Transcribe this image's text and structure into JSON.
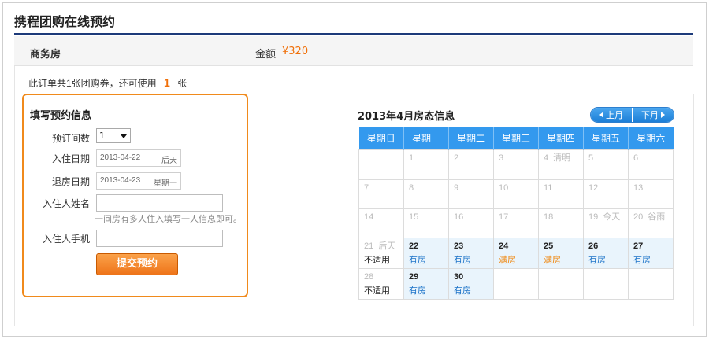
{
  "page": {
    "title": "携程团购在线预约"
  },
  "room": {
    "name": "商务房",
    "amount_label": "金额",
    "amount_value": "¥320"
  },
  "voucher": {
    "text_before": "此订单共1张团购券，还可使用",
    "count": "1",
    "text_after": "张"
  },
  "form": {
    "title": "填写预约信息",
    "rooms_label": "预订间数",
    "rooms_value": "1",
    "checkin_label": "入住日期",
    "checkin_date": "2013-04-22",
    "checkin_day": "后天",
    "checkout_label": "退房日期",
    "checkout_date": "2013-04-23",
    "checkout_day": "星期一",
    "guest_name_label": "入住人姓名",
    "guest_name_value": "",
    "guest_name_hint": "一间房有多人住入填写一人信息即可。",
    "guest_phone_label": "入住人手机",
    "guest_phone_value": "",
    "submit_label": "提交预约"
  },
  "calendar": {
    "title": "2013年4月房态信息",
    "prev_label": "上月",
    "next_label": "下月",
    "weekdays": [
      "星期日",
      "星期一",
      "星期二",
      "星期三",
      "星期四",
      "星期五",
      "星期六"
    ],
    "weeks": [
      [
        {
          "day": "",
          "status": ""
        },
        {
          "day": "1",
          "status": ""
        },
        {
          "day": "2",
          "status": ""
        },
        {
          "day": "3",
          "status": ""
        },
        {
          "day": "4",
          "note": "清明",
          "status": ""
        },
        {
          "day": "5",
          "status": ""
        },
        {
          "day": "6",
          "status": ""
        }
      ],
      [
        {
          "day": "7",
          "status": ""
        },
        {
          "day": "8",
          "status": ""
        },
        {
          "day": "9",
          "status": ""
        },
        {
          "day": "10",
          "status": ""
        },
        {
          "day": "11",
          "status": ""
        },
        {
          "day": "12",
          "status": ""
        },
        {
          "day": "13",
          "status": ""
        }
      ],
      [
        {
          "day": "14",
          "status": ""
        },
        {
          "day": "15",
          "status": ""
        },
        {
          "day": "16",
          "status": ""
        },
        {
          "day": "17",
          "status": ""
        },
        {
          "day": "18",
          "status": ""
        },
        {
          "day": "19",
          "note": "今天",
          "status": ""
        },
        {
          "day": "20",
          "note": "谷雨",
          "status": ""
        }
      ],
      [
        {
          "day": "21",
          "note": "后天",
          "status": "不适用",
          "kind": "na"
        },
        {
          "day": "22",
          "status": "有房",
          "kind": "avail"
        },
        {
          "day": "23",
          "status": "有房",
          "kind": "avail"
        },
        {
          "day": "24",
          "status": "满房",
          "kind": "full"
        },
        {
          "day": "25",
          "status": "满房",
          "kind": "full"
        },
        {
          "day": "26",
          "status": "有房",
          "kind": "avail"
        },
        {
          "day": "27",
          "status": "有房",
          "kind": "avail"
        }
      ],
      [
        {
          "day": "28",
          "status": "不适用",
          "kind": "na"
        },
        {
          "day": "29",
          "status": "有房",
          "kind": "avail"
        },
        {
          "day": "30",
          "status": "有房",
          "kind": "avail"
        },
        {
          "day": "",
          "status": ""
        },
        {
          "day": "",
          "status": ""
        },
        {
          "day": "",
          "status": ""
        },
        {
          "day": "",
          "status": ""
        }
      ]
    ]
  },
  "colors": {
    "accent_orange": "#f0700a",
    "calendar_header_blue": "#3399ee",
    "title_rule": "#1d3a7a"
  }
}
